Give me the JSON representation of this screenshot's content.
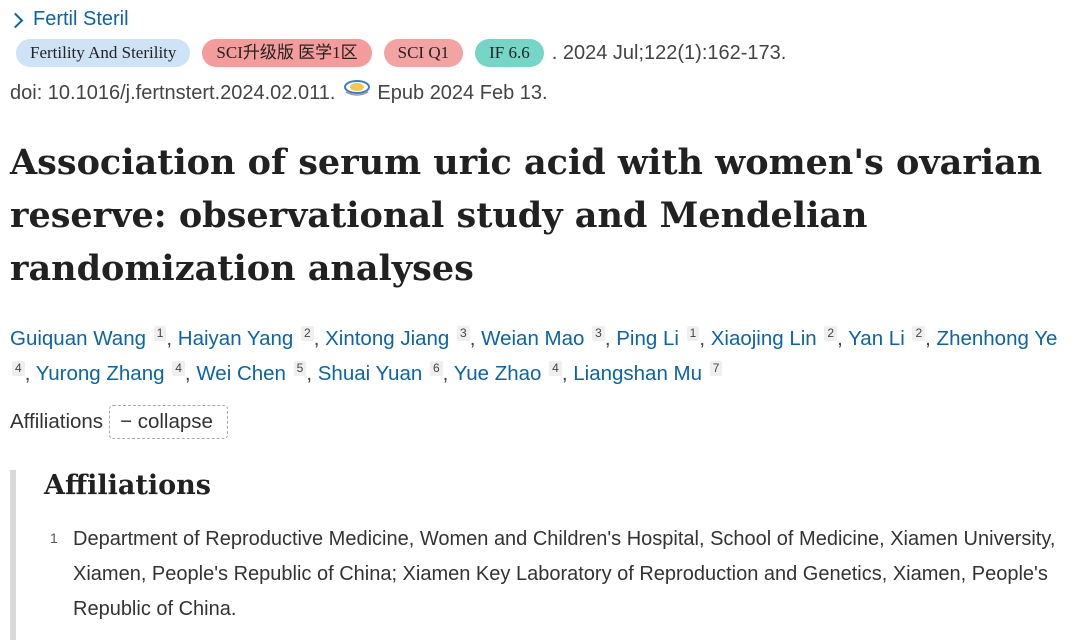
{
  "journal": {
    "name": "Fertil Steril"
  },
  "badges": {
    "journal_full": "Fertility And Sterility",
    "sci_zone": "SCI升级版 医学1区",
    "sci_q": "SCI Q1",
    "impact_factor": "IF 6.6"
  },
  "citation": ". 2024 Jul;122(1):162-173.",
  "doi": "doi: 10.1016/j.fertnstert.2024.02.011.",
  "epub": "Epub 2024 Feb 13.",
  "title": "Association of serum uric acid with women's ovarian reserve: observational study and Mendelian randomization analyses",
  "authors": [
    {
      "name": "Guiquan Wang",
      "aff": "1"
    },
    {
      "name": "Haiyan Yang",
      "aff": "2"
    },
    {
      "name": "Xintong Jiang",
      "aff": "3"
    },
    {
      "name": "Weian Mao",
      "aff": "3"
    },
    {
      "name": "Ping Li",
      "aff": "1"
    },
    {
      "name": "Xiaojing Lin",
      "aff": "2"
    },
    {
      "name": "Yan Li",
      "aff": "2"
    },
    {
      "name": "Zhenhong Ye",
      "aff": "4"
    },
    {
      "name": "Yurong Zhang",
      "aff": "4"
    },
    {
      "name": "Wei Chen",
      "aff": "5"
    },
    {
      "name": "Shuai Yuan",
      "aff": "6"
    },
    {
      "name": "Yue Zhao",
      "aff": "4"
    },
    {
      "name": "Liangshan Mu",
      "aff": "7"
    }
  ],
  "affiliations_toggle": {
    "label": "Affiliations",
    "button": "− collapse"
  },
  "affiliations": {
    "heading": "Affiliations",
    "items": [
      {
        "num": "1",
        "text": "Department of Reproductive Medicine, Women and Children's Hospital, School of Medicine, Xiamen University, Xiamen, People's Republic of China; Xiamen Key Laboratory of Reproduction and Genetics, Xiamen, People's Republic of China."
      }
    ]
  }
}
